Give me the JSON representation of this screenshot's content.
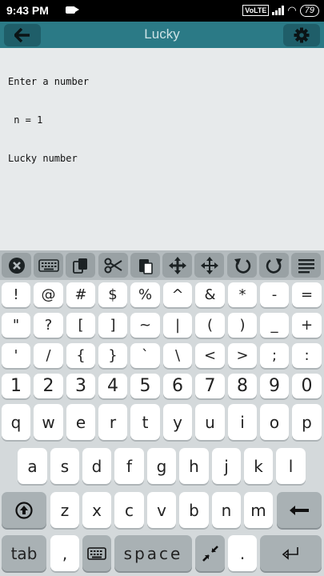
{
  "status_bar": {
    "time": "9:43 PM",
    "volte": "VoLTE",
    "battery": "79"
  },
  "app_bar": {
    "title": "Lucky"
  },
  "console": {
    "lines": [
      "Enter a number",
      " n = 1",
      "Lucky number"
    ]
  },
  "toolbar": {
    "keys": [
      "clear-icon",
      "keyboard-icon",
      "copy-icon",
      "cut-icon",
      "paste-icon",
      "move-cursor-icon",
      "select-move-icon",
      "undo-icon",
      "redo-icon",
      "align-icon"
    ]
  },
  "keyboard": {
    "row1": [
      "!",
      "@",
      "#",
      "$",
      "%",
      "^",
      "&",
      "*",
      "-",
      "="
    ],
    "row2": [
      "\"",
      "?",
      "[",
      "]",
      "~",
      "|",
      "(",
      ")",
      "_",
      "+"
    ],
    "row3": [
      "'",
      "/",
      "{",
      "}",
      "`",
      "\\",
      "<",
      ">",
      ";",
      ":"
    ],
    "row4": [
      "1",
      "2",
      "3",
      "4",
      "5",
      "6",
      "7",
      "8",
      "9",
      "0"
    ],
    "row5": [
      "q",
      "w",
      "e",
      "r",
      "t",
      "y",
      "u",
      "i",
      "o",
      "p"
    ],
    "row6": [
      "a",
      "s",
      "d",
      "f",
      "g",
      "h",
      "j",
      "k",
      "l"
    ],
    "row7": [
      "z",
      "x",
      "c",
      "v",
      "b",
      "n",
      "m"
    ],
    "tab_label": "tab",
    "comma_label": ",",
    "space_label": "space",
    "period_label": "."
  }
}
